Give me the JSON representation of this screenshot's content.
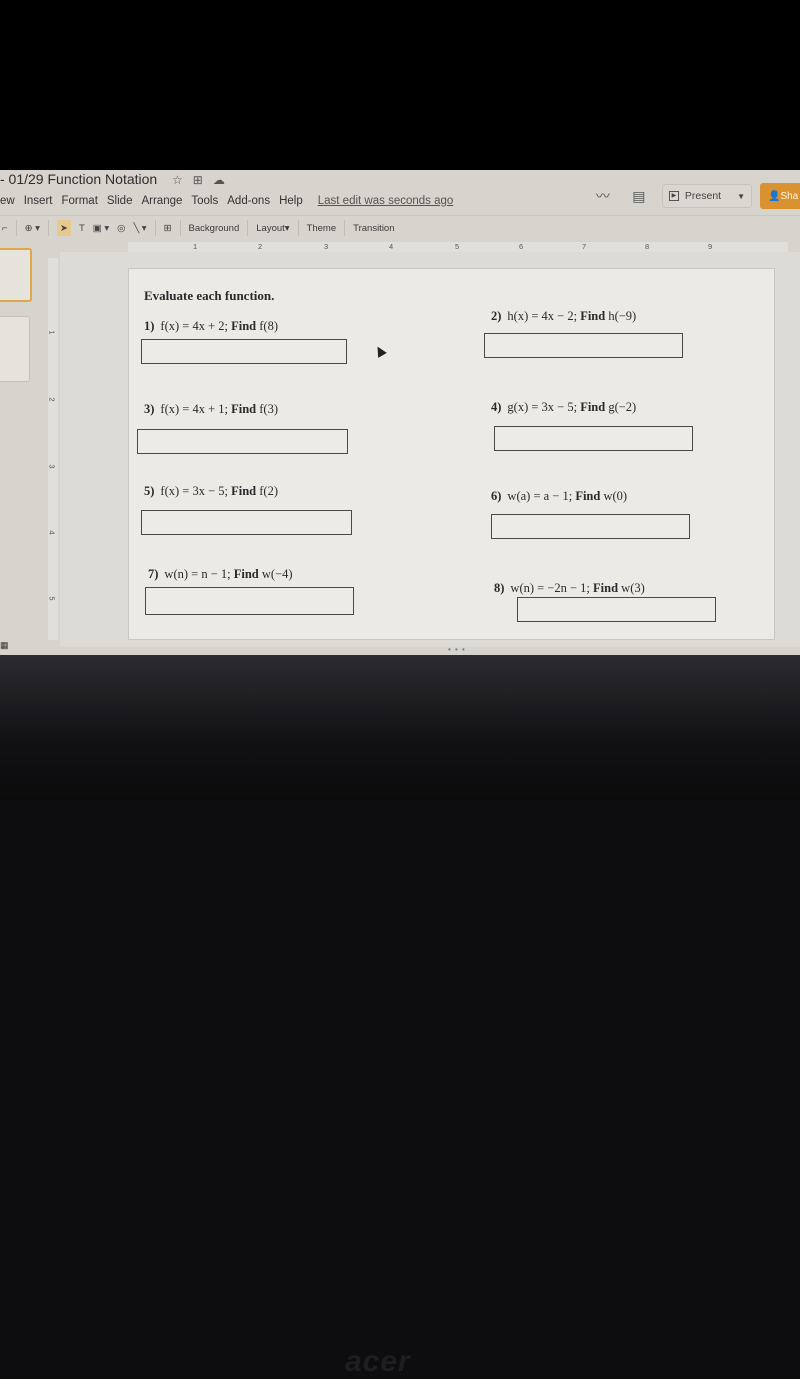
{
  "window": {
    "title": "- 01/29 Function Notation",
    "title_icons": [
      "star-icon",
      "move-to-folder-icon",
      "cloud-saved-icon"
    ]
  },
  "menubar": {
    "items": [
      "ew",
      "Insert",
      "Format",
      "Slide",
      "Arrange",
      "Tools",
      "Add-ons",
      "Help"
    ],
    "last_edit": "Last edit was seconds ago"
  },
  "header_right": {
    "activity_icon": "trending-icon",
    "comment_icon": "comment-icon",
    "present_label": "Present",
    "share_label": "Sha"
  },
  "toolbar": {
    "background_label": "Background",
    "layout_label": "Layout",
    "theme_label": "Theme",
    "transition_label": "Transition"
  },
  "ruler": {
    "horizontal": [
      "1",
      "2",
      "3",
      "4",
      "5",
      "6",
      "7",
      "8",
      "9"
    ],
    "vertical": [
      "1",
      "2",
      "3",
      "4",
      "5"
    ]
  },
  "slide": {
    "heading": "Evaluate each function.",
    "problems": [
      {
        "num": "1)",
        "expr": "f(x) = 4x + 2;",
        "find": "Find",
        "target": "f(8)",
        "answer": ""
      },
      {
        "num": "2)",
        "expr": "h(x) = 4x − 2;",
        "find": "Find",
        "target": "h(−9)",
        "answer": ""
      },
      {
        "num": "3)",
        "expr": "f(x) = 4x + 1;",
        "find": "Find",
        "target": "f(3)",
        "answer": ""
      },
      {
        "num": "4)",
        "expr": "g(x) = 3x − 5;",
        "find": "Find",
        "target": "g(−2)",
        "answer": ""
      },
      {
        "num": "5)",
        "expr": "f(x) = 3x − 5;",
        "find": "Find",
        "target": "f(2)",
        "answer": ""
      },
      {
        "num": "6)",
        "expr": "w(a) = a − 1;",
        "find": "Find",
        "target": "w(0)",
        "answer": ""
      },
      {
        "num": "7)",
        "expr": "w(n) = n − 1;",
        "find": "Find",
        "target": "w(−4)",
        "answer": ""
      },
      {
        "num": "8)",
        "expr": "w(n) = −2n − 1;",
        "find": "Find",
        "target": "w(3)",
        "answer": ""
      }
    ]
  },
  "monitor": {
    "brand": "acer"
  }
}
